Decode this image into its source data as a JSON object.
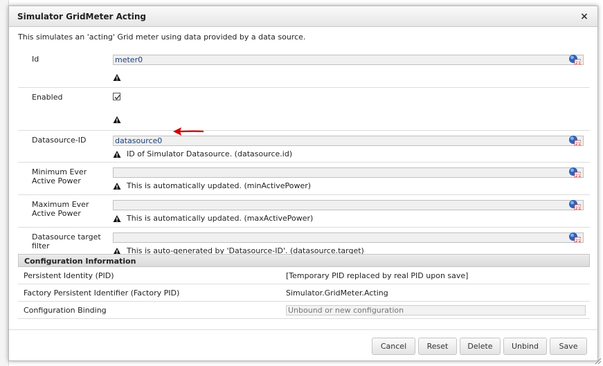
{
  "dialog": {
    "title": "Simulator GridMeter Acting",
    "close_label": "×",
    "description": "This simulates an 'acting' Grid meter using data provided by a data source."
  },
  "fields": [
    {
      "label": "Id",
      "value": "meter0",
      "hint": ""
    },
    {
      "label": "Enabled",
      "checked": true,
      "hint": ""
    },
    {
      "label": "Datasource-ID",
      "value": "datasource0",
      "hint": "ID of Simulator Datasource. (datasource.id)"
    },
    {
      "label": "Minimum Ever Active Power",
      "value": "",
      "hint": "This is automatically updated. (minActivePower)"
    },
    {
      "label": "Maximum Ever Active Power",
      "value": "",
      "hint": "This is automatically updated. (maxActivePower)"
    },
    {
      "label": "Datasource target filter",
      "value": "",
      "hint": "This is auto-generated by 'Datasource-ID'. (datasource.target)"
    }
  ],
  "config": {
    "header": "Configuration Information",
    "pid_label": "Persistent Identity (PID)",
    "pid_value": "[Temporary PID replaced by real PID upon save]",
    "factory_label": "Factory Persistent Identifier (Factory PID)",
    "factory_value": "Simulator.GridMeter.Acting",
    "binding_label": "Configuration Binding",
    "binding_placeholder": "Unbound or new configuration"
  },
  "buttons": {
    "cancel": "Cancel",
    "reset": "Reset",
    "delete": "Delete",
    "unbind": "Unbind",
    "save": "Save"
  },
  "icons": {
    "globe": "globe-variable-icon",
    "warning": "warning-icon",
    "arrow": "red-arrow-annotation",
    "arrow_color": "#d40000"
  }
}
